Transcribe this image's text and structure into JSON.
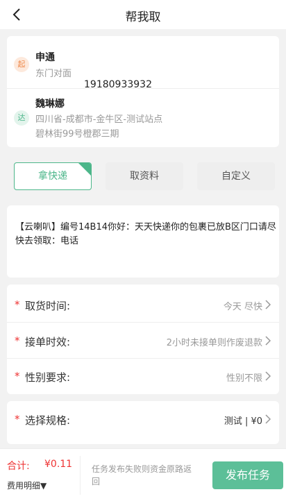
{
  "header": {
    "title": "帮我取",
    "back_icon": "chevron-left-icon"
  },
  "pickup": {
    "badge": "起",
    "name": "申通",
    "address": "东门对面"
  },
  "delivery": {
    "badge": "达",
    "name": "魏琳娜",
    "phone": "19180933932",
    "address_line1": "四川省-成都市-金牛区-测试站点",
    "address_line2": "碧林街99号橙郡三期"
  },
  "types": [
    {
      "label": "拿快递",
      "selected": true
    },
    {
      "label": "取资料",
      "selected": false
    },
    {
      "label": "自定义",
      "selected": false
    }
  ],
  "message": "【云喇叭】编号14B14你好：天天快递你的包裹已放B区门口请尽快去领取：电话",
  "form": [
    {
      "label": "取货时间:",
      "value": "今天 尽快",
      "required": true
    },
    {
      "label": "接单时效:",
      "value": "2小时未接单则作废退款",
      "required": true
    },
    {
      "label": "性别要求:",
      "value": "性别不限",
      "required": true
    },
    {
      "label": "选择规格:",
      "value": "测试 | ¥0",
      "required": true
    }
  ],
  "required_mark": "*",
  "footer": {
    "total_label": "合计:",
    "total_value": "¥0.11",
    "detail_label": "费用明细▼",
    "note": "任务发布失败则资金原路返回",
    "publish_label": "发布任务"
  },
  "colors": {
    "accent": "#4cb68a",
    "publish": "#5cbf98",
    "required": "#e33333"
  }
}
